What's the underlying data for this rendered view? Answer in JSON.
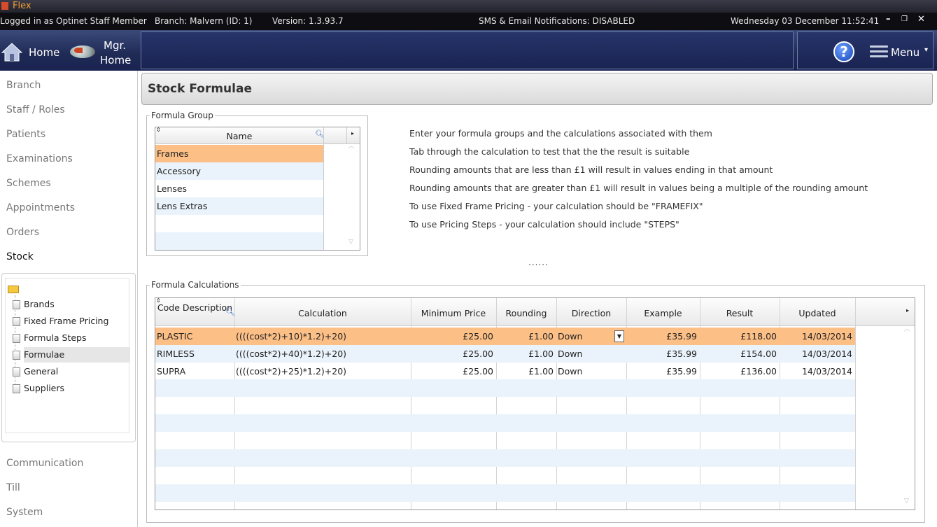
{
  "app": {
    "title": "Flex"
  },
  "status": {
    "logged_in": "Logged in as Optinet Staff Member",
    "branch": "Branch: Malvern (ID:  1)",
    "version": "Version: 1.3.93.7",
    "notifications": "SMS & Email Notifications: DISABLED",
    "datetime": "Wednesday 03 December 11:52:41"
  },
  "nav": {
    "home": "Home",
    "mgr_home_line1": "Mgr.",
    "mgr_home_line2": "Home",
    "menu": "Menu",
    "help": "?"
  },
  "sidebar": {
    "items": [
      "Branch",
      "Staff / Roles",
      "Patients",
      "Examinations",
      "Schemes",
      "Appointments",
      "Orders",
      "Stock"
    ],
    "bottom_items": [
      "Communication",
      "Till",
      "System"
    ],
    "stock_sub": [
      "Brands",
      "Fixed Frame Pricing",
      "Formula Steps",
      "Formulae",
      "General",
      "Suppliers"
    ]
  },
  "page": {
    "title": "Stock Formulae"
  },
  "formula_group": {
    "legend": "Formula Group",
    "column": "Name",
    "rows": [
      "Frames",
      "Accessory",
      "Lenses",
      "Lens Extras"
    ]
  },
  "info_lines": [
    "Enter your formula groups and the calculations associated with them",
    "Tab through the calculation to test that the the result is suitable",
    "Rounding amounts that are less than £1 will result in values ending in that amount",
    "Rounding amounts that are greater than £1 will result in values being a multiple of the rounding amount",
    "To use Fixed Frame Pricing - your calculation should be \"FRAMEFIX\"",
    "To use Pricing Steps - your calculation should include \"STEPS\""
  ],
  "splitter": "......",
  "formula_calculations": {
    "legend": "Formula Calculations",
    "columns": [
      "Code Description",
      "Calculation",
      "Minimum Price",
      "Rounding",
      "Direction",
      "Example",
      "Result",
      "Updated"
    ],
    "rows": [
      [
        "PLASTIC",
        "((((cost*2)+10)*1.2)+20)",
        "£25.00",
        "£1.00",
        "Down",
        "£35.99",
        "£118.00",
        "14/03/2014"
      ],
      [
        "RIMLESS",
        "((((cost*2)+40)*1.2)+20)",
        "£25.00",
        "£1.00",
        "Down",
        "£35.99",
        "£154.00",
        "14/03/2014"
      ],
      [
        "SUPRA",
        "((((cost*2)+25)*1.2)+20)",
        "£25.00",
        "£1.00",
        "Down",
        "£35.99",
        "£136.00",
        "14/03/2014"
      ]
    ]
  },
  "colors": {
    "selected_row": "#fcbf86",
    "alt_row": "#eaf3fb",
    "nav_bg": "#1f2a55"
  }
}
